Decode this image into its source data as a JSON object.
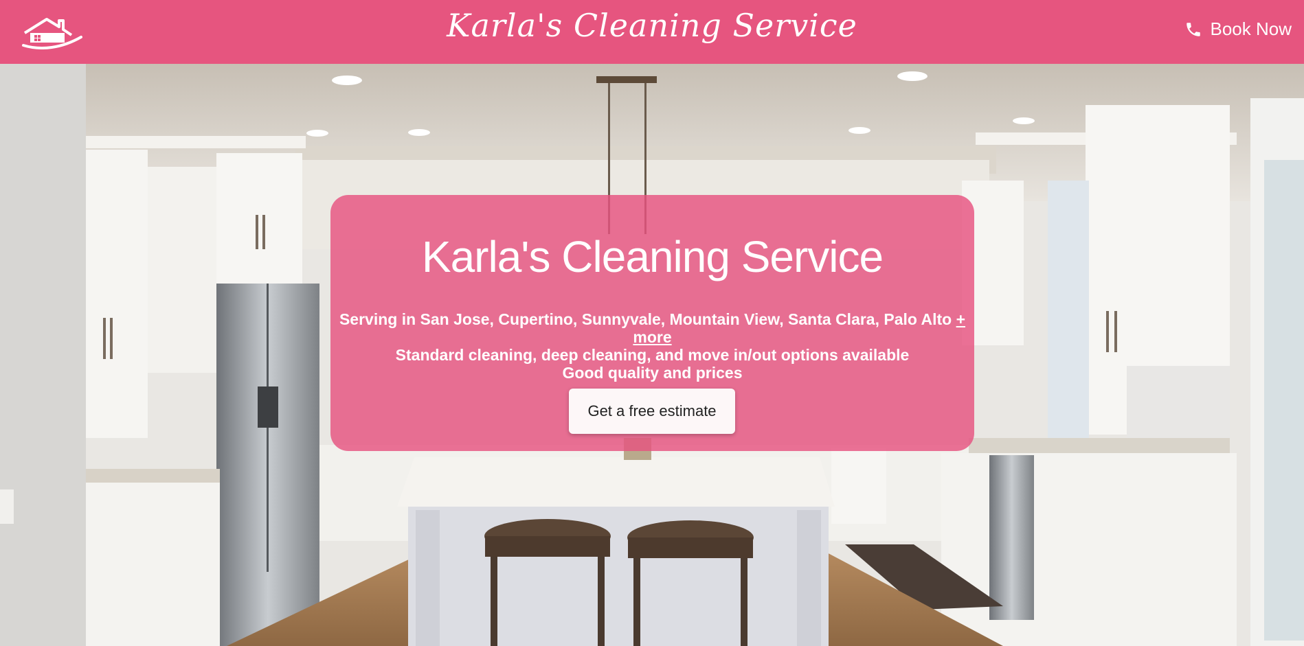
{
  "header": {
    "brand": "Karla's Cleaning Service",
    "book_label": "Book Now"
  },
  "hero": {
    "title": "Karla's Cleaning Service",
    "service_area": "Serving in San Jose, Cupertino, Sunnyvale, Mountain View, Santa Clara, Palo Alto",
    "more_link": "+ more",
    "options": "Standard cleaning, deep cleaning, and move in/out options available",
    "quality": "Good quality and prices",
    "cta_label": "Get a free estimate"
  },
  "colors": {
    "brand_pink": "#e6557f",
    "card_pink": "#e65380",
    "cta_bg": "#fdf7f8"
  },
  "icons": {
    "logo": "house-logo-icon",
    "book": "phone-icon"
  }
}
